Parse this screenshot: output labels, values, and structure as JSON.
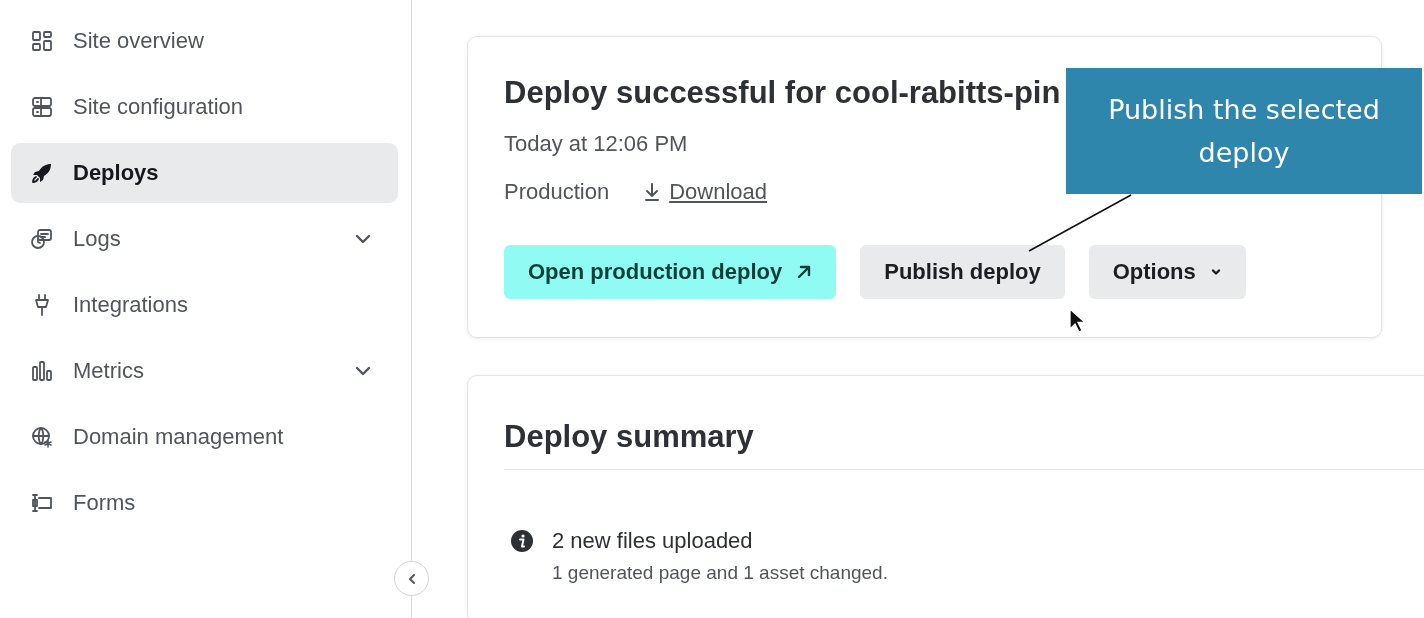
{
  "sidebar": {
    "items": [
      {
        "label": "Site overview",
        "selected": false,
        "expandable": false
      },
      {
        "label": "Site configuration",
        "selected": false,
        "expandable": false
      },
      {
        "label": "Deploys",
        "selected": true,
        "expandable": false
      },
      {
        "label": "Logs",
        "selected": false,
        "expandable": true
      },
      {
        "label": "Integrations",
        "selected": false,
        "expandable": false
      },
      {
        "label": "Metrics",
        "selected": false,
        "expandable": true
      },
      {
        "label": "Domain management",
        "selected": false,
        "expandable": false
      },
      {
        "label": "Forms",
        "selected": false,
        "expandable": false
      }
    ]
  },
  "deploy_card": {
    "title": "Deploy successful for cool-rabitts-pin",
    "time": "Today at 12:06 PM",
    "context": "Production",
    "download_link": "Download",
    "buttons": [
      {
        "label": "Open production deploy",
        "kind": "primary"
      },
      {
        "label": "Publish deploy",
        "kind": "secondary"
      },
      {
        "label": "Options",
        "kind": "dropdown"
      }
    ]
  },
  "tooltip": {
    "text": "Publish the selected deploy"
  },
  "summary": {
    "title": "Deploy summary",
    "items": [
      {
        "title": "2 new files uploaded",
        "detail": "1 generated page and 1 asset changed."
      }
    ]
  }
}
